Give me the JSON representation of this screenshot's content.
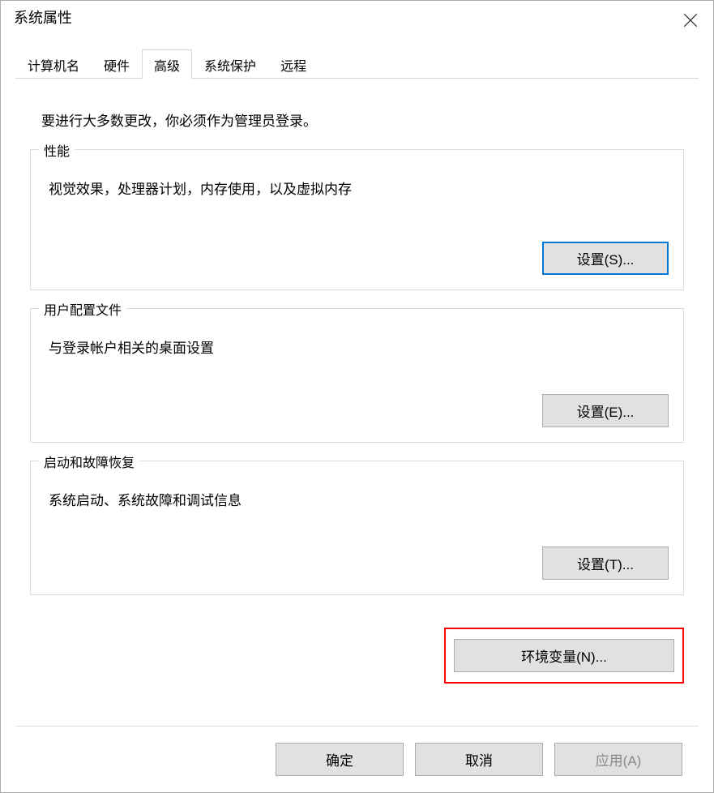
{
  "window": {
    "title": "系统属性"
  },
  "tabs": [
    {
      "label": "计算机名"
    },
    {
      "label": "硬件"
    },
    {
      "label": "高级",
      "active": true
    },
    {
      "label": "系统保护"
    },
    {
      "label": "远程"
    }
  ],
  "admin_note": "要进行大多数更改，你必须作为管理员登录。",
  "groups": {
    "performance": {
      "label": "性能",
      "desc": "视觉效果，处理器计划，内存使用，以及虚拟内存",
      "button": "设置(S)..."
    },
    "profiles": {
      "label": "用户配置文件",
      "desc": "与登录帐户相关的桌面设置",
      "button": "设置(E)..."
    },
    "startup": {
      "label": "启动和故障恢复",
      "desc": "系统启动、系统故障和调试信息",
      "button": "设置(T)..."
    }
  },
  "env_button": "环境变量(N)...",
  "footer": {
    "ok": "确定",
    "cancel": "取消",
    "apply": "应用(A)"
  }
}
